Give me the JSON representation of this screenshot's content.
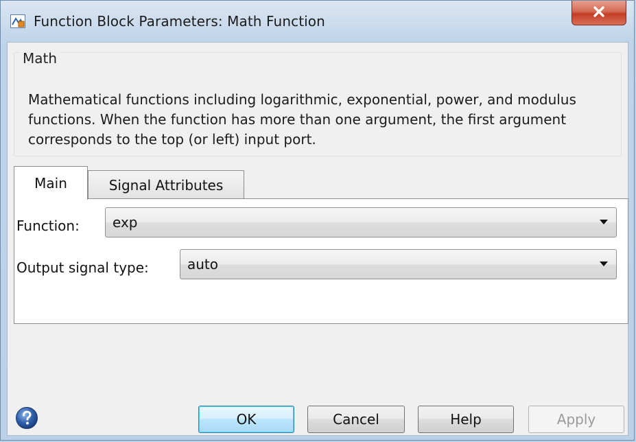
{
  "window": {
    "title": "Function Block Parameters: Math Function",
    "close_glyph": "X"
  },
  "group": {
    "legend": "Math",
    "description": "Mathematical functions including logarithmic, exponential, power, and modulus functions.  When the function has more than one argument, the first argument corresponds to the top (or left) input port."
  },
  "tabs": [
    {
      "label": "Main",
      "selected": true
    },
    {
      "label": "Signal Attributes",
      "selected": false
    }
  ],
  "fields": {
    "function": {
      "label": "Function:",
      "value": "exp"
    },
    "output_signal_type": {
      "label": "Output signal type:",
      "value": "auto"
    }
  },
  "buttons": {
    "ok": "OK",
    "cancel": "Cancel",
    "help": "Help",
    "apply": "Apply"
  },
  "icons": {
    "title": "simulink-block-icon",
    "help": "question-mark-icon",
    "dropdown": "chevron-down-icon"
  },
  "colors": {
    "titlebar": "#c9daec",
    "close_button": "#c43d25",
    "help_icon": "#2f5faa",
    "ok_button_border": "#3c7fb1"
  }
}
